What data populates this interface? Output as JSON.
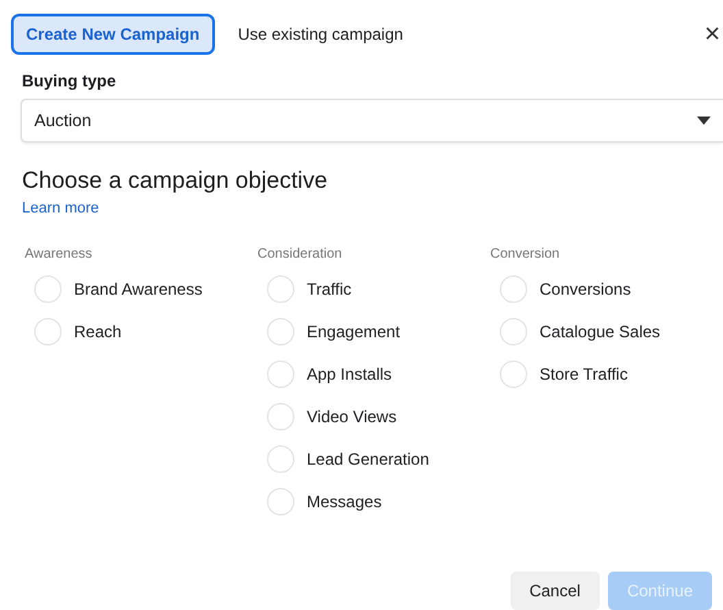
{
  "tabs": [
    {
      "label": "Create New Campaign",
      "selected": true
    },
    {
      "label": "Use existing campaign",
      "selected": false
    }
  ],
  "close": "×",
  "buying_type": {
    "label": "Buying type",
    "value": "Auction"
  },
  "objective": {
    "title": "Choose a campaign objective",
    "link": "Learn more"
  },
  "groups": [
    {
      "label": "Awareness",
      "options": [
        {
          "label": "Brand Awareness",
          "selected": false
        },
        {
          "label": "Reach",
          "selected": false
        }
      ]
    },
    {
      "label": "Consideration",
      "options": [
        {
          "label": "Traffic",
          "selected": false
        },
        {
          "label": "Engagement",
          "selected": false
        },
        {
          "label": "App Installs",
          "selected": false
        },
        {
          "label": "Video Views",
          "selected": false
        },
        {
          "label": "Lead Generation",
          "selected": false
        },
        {
          "label": "Messages",
          "selected": false
        }
      ]
    },
    {
      "label": "Conversion",
      "options": [
        {
          "label": "Conversions",
          "selected": false
        },
        {
          "label": "Catalogue Sales",
          "selected": false
        },
        {
          "label": "Store Traffic",
          "selected": false
        }
      ]
    }
  ],
  "buttons": [
    {
      "label": "Cancel",
      "disabled": false,
      "kind": "secondary"
    },
    {
      "label": "Continue",
      "disabled": true,
      "kind": "primary"
    }
  ]
}
